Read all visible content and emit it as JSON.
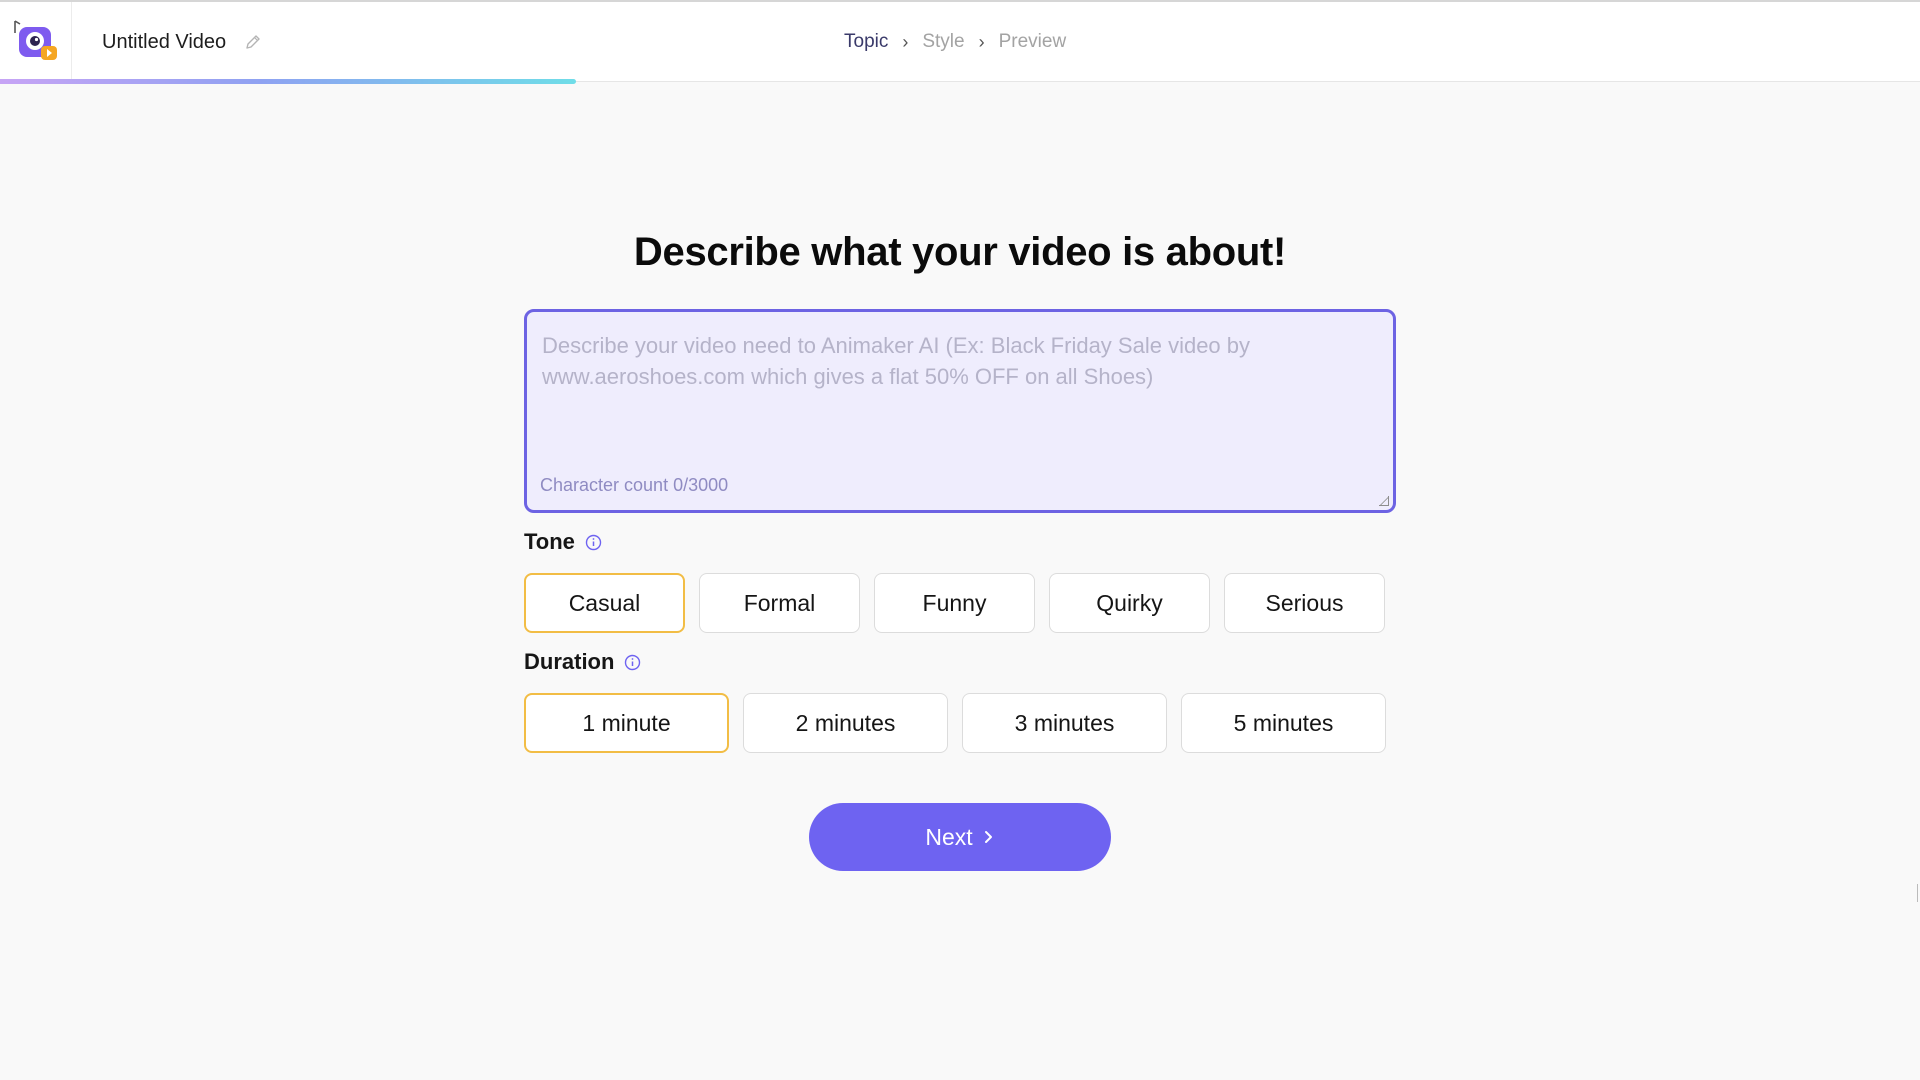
{
  "header": {
    "title": "Untitled Video",
    "logo_icon": "animaker-camera-logo-icon",
    "edit_icon": "pencil-icon",
    "progress_fraction": 0.3
  },
  "breadcrumb": {
    "steps": [
      {
        "label": "Topic",
        "state": "active"
      },
      {
        "label": "Style",
        "state": "inactive"
      },
      {
        "label": "Preview",
        "state": "inactive"
      }
    ],
    "separator": "›"
  },
  "main": {
    "heading": "Describe what your video is about!",
    "description": {
      "value": "",
      "placeholder": "Describe your video need to Animaker AI (Ex: Black Friday Sale video by www.aeroshoes.com which gives a flat 50% OFF on all Shoes)",
      "char_count_label": "Character count 0/3000"
    },
    "tone": {
      "label": "Tone",
      "options": [
        "Casual",
        "Formal",
        "Funny",
        "Quirky",
        "Serious"
      ],
      "selected": "Casual"
    },
    "duration": {
      "label": "Duration",
      "options": [
        "1 minute",
        "2 minutes",
        "3 minutes",
        "5 minutes"
      ],
      "selected": "1 minute"
    },
    "next_label": "Next",
    "next_icon": "chevron-right-icon"
  },
  "colors": {
    "accent": "#6e63f1",
    "selected_border": "#f2bd45",
    "textarea_bg": "#efedfd",
    "page_bg": "#f9f9f9"
  }
}
